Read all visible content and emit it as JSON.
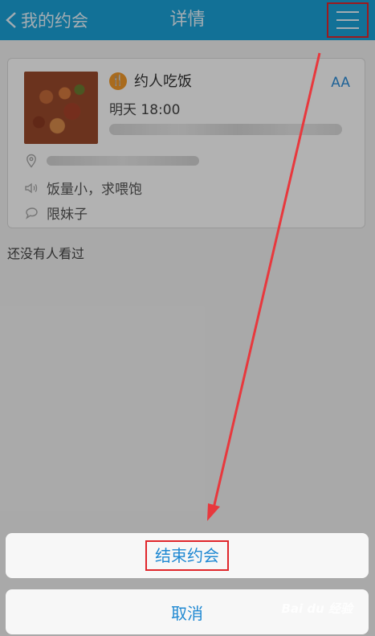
{
  "header": {
    "back_label": "我的约会",
    "title": "详情"
  },
  "card": {
    "category": "约人吃饭",
    "font_toggle": "AA",
    "time": "明天 18:00",
    "note": "饭量小，求喂饱",
    "target": "限妹子"
  },
  "views_text": "还没有人看过",
  "action_sheet": {
    "end_label": "结束约会",
    "cancel_label": "取消"
  },
  "watermark": "Bai du 经验",
  "colors": {
    "header": "#1aa3d8",
    "accent": "#1e88d2",
    "highlight": "#e0262b",
    "category_badge": "#f39a2a"
  }
}
